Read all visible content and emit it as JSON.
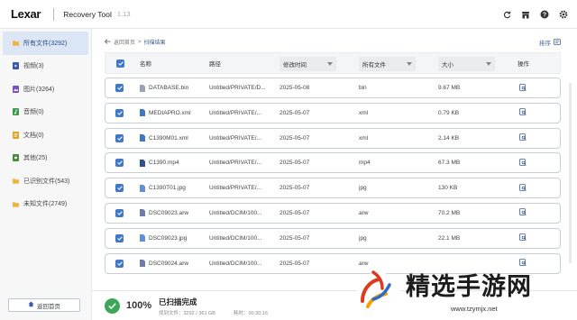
{
  "app": {
    "logo": "Lexar",
    "title": "Recovery Tool",
    "version": "1.13"
  },
  "title_icons": [
    "refresh-icon",
    "store-icon",
    "help-icon",
    "settings-icon"
  ],
  "sidebar": {
    "items": [
      {
        "label": "所有文件(3292)",
        "icon": "folder-icon",
        "color": "#f0b43c",
        "active": true
      },
      {
        "label": "视频(3)",
        "icon": "video-file-icon",
        "color": "#3a5aa8"
      },
      {
        "label": "图片(3264)",
        "icon": "image-file-icon",
        "color": "#7a4fc0"
      },
      {
        "label": "音频(0)",
        "icon": "audio-file-icon",
        "color": "#3a9a4a"
      },
      {
        "label": "文档(0)",
        "icon": "document-file-icon",
        "color": "#e0a020"
      },
      {
        "label": "其他(25)",
        "icon": "other-file-icon",
        "color": "#4a8a3a"
      },
      {
        "label": "已识别文件(543)",
        "icon": "folder-icon",
        "color": "#f0b43c"
      },
      {
        "label": "未知文件(2749)",
        "icon": "folder-icon",
        "color": "#f0b43c"
      }
    ],
    "home_button": "返回首页"
  },
  "breadcrumb": {
    "back": "返回首页",
    "current": "扫描结果"
  },
  "sort_label": "排序",
  "table": {
    "headers": {
      "name": "名称",
      "path": "路径",
      "modified": "修改时间",
      "type": "所有文件",
      "size": "大小",
      "action": "操作"
    },
    "rows": [
      {
        "name": "DATABASE.bin",
        "path": "Untitled/PRIVATE/D...",
        "date": "2025-05-08",
        "type": "bin",
        "size": "9.67 MB"
      },
      {
        "name": "MEDIAPRO.xml",
        "path": "Untitled/PRIVATE/...",
        "date": "2025-05-07",
        "type": "xml",
        "size": "0.79 KB"
      },
      {
        "name": "C1390M01.xml",
        "path": "Untitled/PRIVATE/...",
        "date": "2025-05-07",
        "type": "xml",
        "size": "2.14 KB"
      },
      {
        "name": "C1390.mp4",
        "path": "Untitled/PRIVATE/...",
        "date": "2025-05-07",
        "type": "mp4",
        "size": "67.3 MB"
      },
      {
        "name": "C1390T01.jpg",
        "path": "Untitled/PRIVATE/...",
        "date": "2025-05-07",
        "type": "jpg",
        "size": "130 KB"
      },
      {
        "name": "DSC09023.arw",
        "path": "Untitled/DCIM/100...",
        "date": "2025-05-07",
        "type": "arw",
        "size": "70.2 MB"
      },
      {
        "name": "DSC09023.jpg",
        "path": "Untitled/DCIM/100...",
        "date": "2025-05-07",
        "type": "jpg",
        "size": "22.1 MB"
      },
      {
        "name": "DSC09024.arw",
        "path": "Untitled/DCIM/100...",
        "date": "2025-05-07",
        "type": "arw",
        "size": ""
      }
    ]
  },
  "status": {
    "percent": "100%",
    "title": "已扫描完成",
    "found": "找到文件：3292 / 361 GB",
    "elapsed": "耗时：00:30:16"
  },
  "watermark": {
    "text": "精选手游网",
    "url": "www.tzymjx.net"
  },
  "colors": {
    "accent": "#3f78c8",
    "success": "#3ea65a",
    "selected_bg": "#dde6f4"
  }
}
